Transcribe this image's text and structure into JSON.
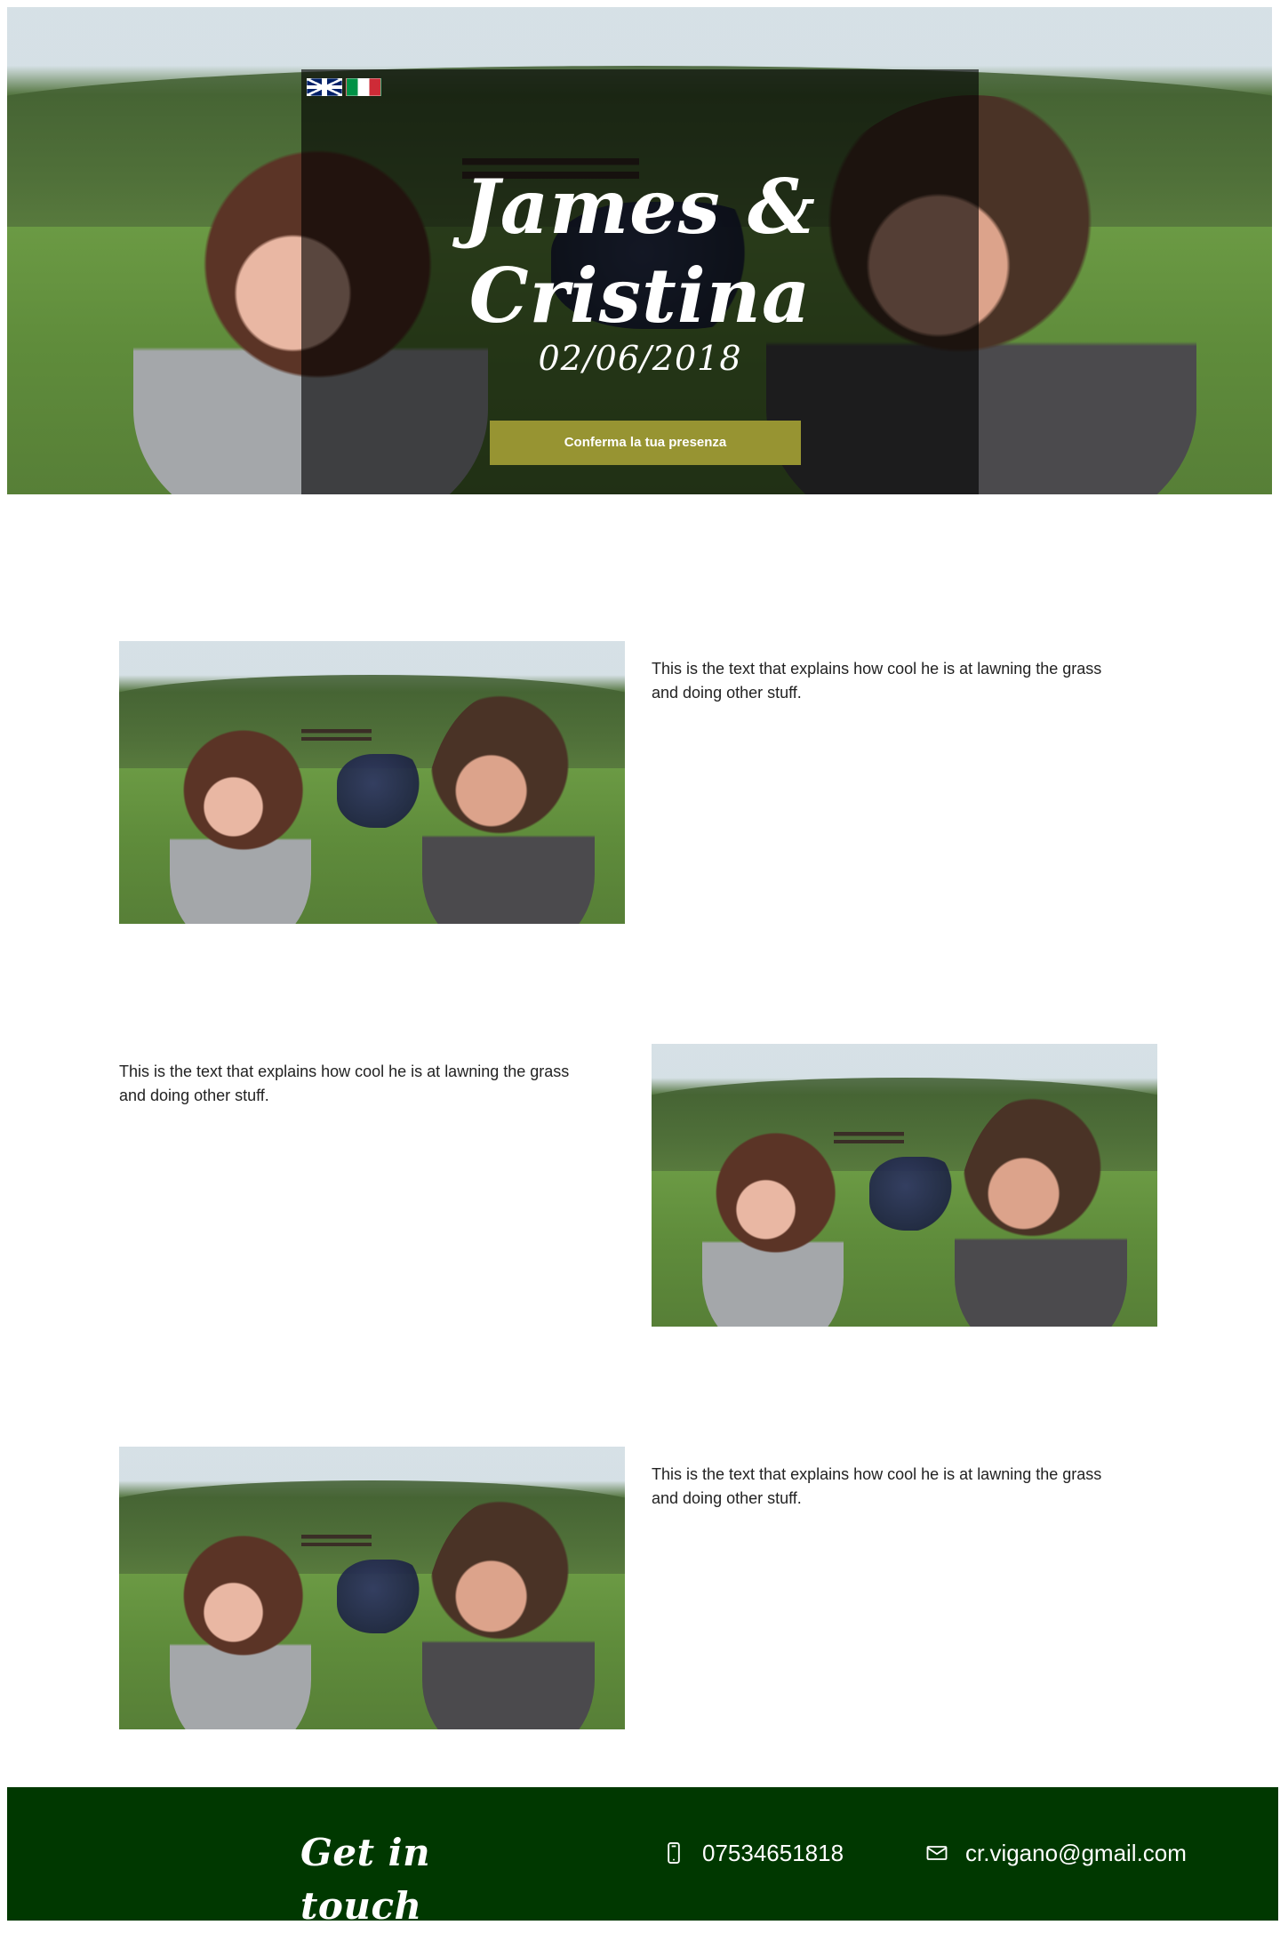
{
  "hero": {
    "title": "James & Cristina",
    "date": "02/06/2018",
    "cta_label": "Conferma la tua presenza",
    "language_flags": [
      {
        "icon": "uk-flag-icon"
      },
      {
        "icon": "italy-flag-icon"
      }
    ]
  },
  "sections": [
    {
      "text": "This is the text that explains how cool he is at lawning the grass and doing other stuff."
    },
    {
      "text": "This is the text that explains how cool he is at lawning the grass and doing other stuff."
    },
    {
      "text": "This is the text that explains how cool he is at lawning the grass and doing other stuff."
    }
  ],
  "footer": {
    "title": "Get in touch",
    "phone": "07534651818",
    "email": "cr.vigano@gmail.com",
    "phone_icon": "mobile-phone-icon",
    "email_icon": "envelope-icon"
  },
  "colors": {
    "button": "#979432",
    "footer_bg": "#003800",
    "hero_overlay": "rgba(0,0,0,0.62)"
  }
}
